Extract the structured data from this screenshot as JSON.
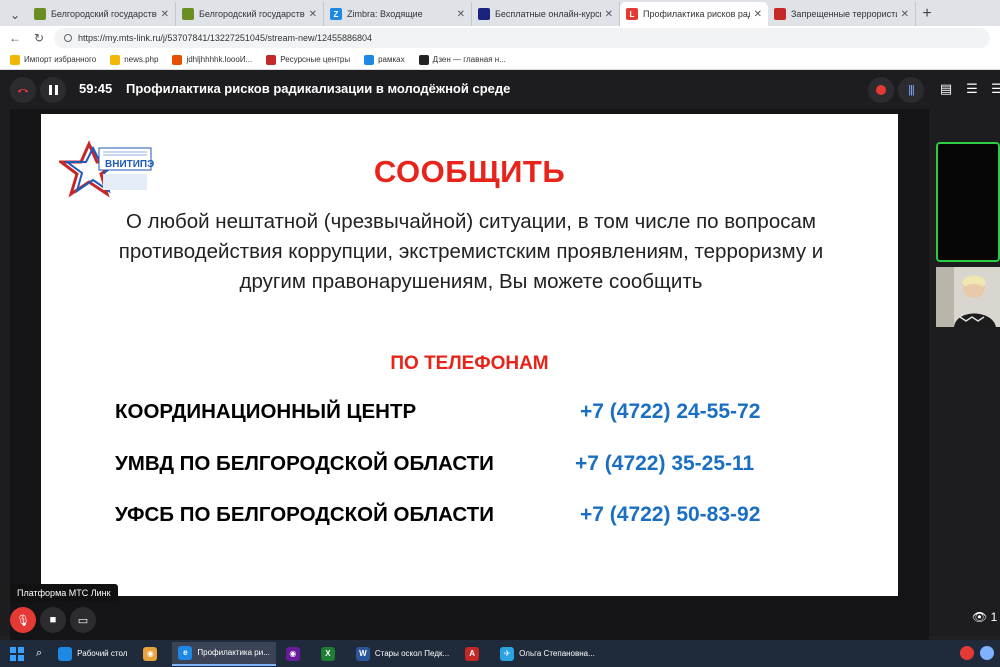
{
  "browser": {
    "tabs": [
      {
        "title": "Белгородский государственный",
        "fav_color": "#6b8e23",
        "fav_glyph": ""
      },
      {
        "title": "Белгородский государственный",
        "fav_color": "#6b8e23",
        "fav_glyph": ""
      },
      {
        "title": "Zimbra: Входящие",
        "fav_color": "#1e88e5",
        "fav_glyph": "Z"
      },
      {
        "title": "Бесплатные онлайн-курсы повы",
        "fav_color": "#1a237e",
        "fav_glyph": ""
      },
      {
        "title": "Профилактика рисков ради",
        "fav_color": "#e53935",
        "fav_glyph": "L",
        "active": true
      },
      {
        "title": "Запрещенные террористически",
        "fav_color": "#c62828",
        "fav_glyph": ""
      }
    ],
    "url": "https://my.mts-link.ru/j/53707841/13227251045/stream-new/12455886804",
    "bookmarks": [
      {
        "label": "Импорт избранного",
        "color": "#f2b705"
      },
      {
        "label": "news.php",
        "color": "#f2b705"
      },
      {
        "label": "jdhljhhhhk.loooИ...",
        "color": "#e65100"
      },
      {
        "label": "Ресурсные центры",
        "color": "#c62828"
      },
      {
        "label": "рамках",
        "color": "#1e88e5"
      },
      {
        "label": "Дзен — главная н...",
        "color": "#222222"
      }
    ]
  },
  "meeting": {
    "timer": "59:45",
    "title": "Профилактика рисков радикализации в молодёжной среде",
    "platform_label": "Платформа МТС Линк",
    "viewers_count": "1"
  },
  "slide": {
    "logo_text": "ВНИТИПЭ",
    "heading": "СООБЩИТЬ",
    "body": "О любой нештатной (чрезвычайной) ситуации, в том числе по вопросам противодействия коррупции, экстремистским проявлениям, терроризму и другим правонарушениям, Вы можете сообщить",
    "subheading": "ПО ТЕЛЕФОНАМ",
    "contacts": [
      {
        "org": "КООРДИНАЦИОННЫЙ ЦЕНТР",
        "phone": "+7 (4722) 24-55-72"
      },
      {
        "org": "УМВД ПО БЕЛГОРОДСКОЙ ОБЛАСТИ",
        "phone": "+7 (4722) 35-25-11"
      },
      {
        "org": "УФСБ ПО БЕЛГОРОДСКОЙ ОБЛАСТИ",
        "phone": "+7 (4722) 50-83-92"
      }
    ],
    "colors": {
      "accent_red": "#e8231a",
      "phone_blue": "#1a6fc4"
    }
  },
  "taskbar": {
    "items": [
      {
        "label": "Рабочий стол",
        "color": "#1e88e5",
        "glyph": ""
      },
      {
        "label": "",
        "color": "#e8a33d",
        "glyph": "◉"
      },
      {
        "label": "Профилактика ри...",
        "color": "#1e88e5",
        "glyph": "e",
        "active": true
      },
      {
        "label": "",
        "color": "#6a1b9a",
        "glyph": "◉"
      },
      {
        "label": "",
        "color": "#1e7e34",
        "glyph": "X"
      },
      {
        "label": "Стары оскол Педк...",
        "color": "#2b579a",
        "glyph": "W"
      },
      {
        "label": "",
        "color": "#c62828",
        "glyph": "A"
      },
      {
        "label": "Ольга Степановна...",
        "color": "#2aa3e0",
        "glyph": "✈"
      }
    ]
  }
}
